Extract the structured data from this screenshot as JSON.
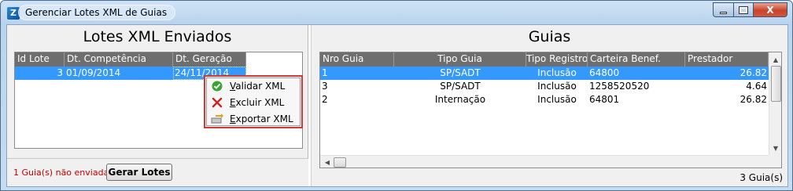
{
  "window": {
    "title": "Gerenciar Lotes XML de Guias",
    "minimize_label": "_",
    "maximize_label": "□",
    "close_label": "X"
  },
  "lotes": {
    "title": "Lotes XML Enviados",
    "columns": [
      "Id Lote",
      "Dt. Competência",
      "Dt. Geração"
    ],
    "rows": [
      {
        "id": "3",
        "competencia": "01/09/2014",
        "geracao": "24/11/2014"
      }
    ],
    "footer_status": "1 Guia(s) não enviadas",
    "gerar_button": "Gerar Lotes"
  },
  "context_menu": {
    "items": [
      {
        "accel": "V",
        "rest": "alidar XML",
        "icon": "check-shield-icon"
      },
      {
        "accel": "E",
        "rest": "xcluir XML",
        "icon": "red-x-icon"
      },
      {
        "accel": "E",
        "rest": "xportar XML",
        "icon": "export-icon"
      }
    ]
  },
  "guias": {
    "title": "Guias",
    "columns": [
      "Nro Guia",
      "Tipo Guia",
      "Tipo Registro",
      "Carteira Benef.",
      "Prestador"
    ],
    "rows": [
      {
        "nro": "1",
        "tipo": "SP/SADT",
        "registro": "Inclusão",
        "carteira": "64800",
        "prestador": "26.82"
      },
      {
        "nro": "3",
        "tipo": "SP/SADT",
        "registro": "Inclusão",
        "carteira": "1258520520",
        "prestador": "4.64"
      },
      {
        "nro": "2",
        "tipo": "Internação",
        "registro": "Inclusão",
        "carteira": "64801",
        "prestador": "26.82"
      }
    ],
    "footer_count": "3 Guia(s)"
  },
  "colors": {
    "selection": "#3399ff",
    "header": "#6e6e6e",
    "warning_text": "#c80000",
    "menu_highlight_border": "#d23a36"
  }
}
